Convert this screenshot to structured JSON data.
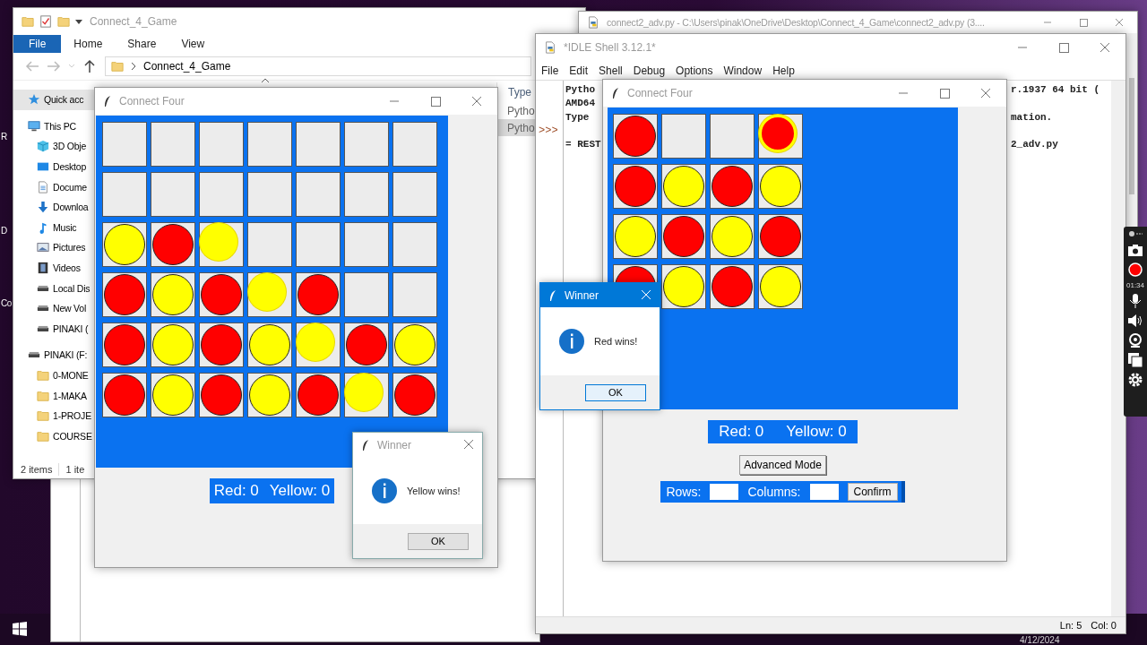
{
  "desktop": {
    "edge_labels": [
      "R",
      "D",
      "Co"
    ]
  },
  "explorer": {
    "title": "Connect_4_Game",
    "ribbon_tabs": [
      {
        "label": "File",
        "selected": true
      },
      {
        "label": "Home",
        "selected": false
      },
      {
        "label": "Share",
        "selected": false
      },
      {
        "label": "View",
        "selected": false
      }
    ],
    "address": "Connect_4_Game",
    "nav": [
      {
        "label": "Quick acc",
        "kind": "star",
        "selected": true
      },
      {
        "label": "This PC",
        "kind": "pc",
        "selected": false,
        "children": [
          {
            "label": "3D Obje",
            "kind": "cube",
            "selected": false
          },
          {
            "label": "Desktop",
            "kind": "desktop",
            "selected": false
          },
          {
            "label": "Docume",
            "kind": "document",
            "selected": false
          },
          {
            "label": "Downloa",
            "kind": "download",
            "selected": false
          },
          {
            "label": "Music",
            "kind": "music",
            "selected": false
          },
          {
            "label": "Pictures",
            "kind": "picture",
            "selected": false
          },
          {
            "label": "Videos",
            "kind": "film",
            "selected": false
          },
          {
            "label": "Local Dis",
            "kind": "drive",
            "selected": false
          },
          {
            "label": "New Vol",
            "kind": "drive",
            "selected": false
          },
          {
            "label": "PINAKI (",
            "kind": "drive",
            "selected": false
          }
        ]
      },
      {
        "label": "PINAKI (F:",
        "kind": "drive",
        "selected": false,
        "children": [
          {
            "label": "0-MONE",
            "kind": "folder",
            "selected": false
          },
          {
            "label": "1-MAKA",
            "kind": "folder",
            "selected": false
          },
          {
            "label": "1-PROJE",
            "kind": "folder",
            "selected": false
          },
          {
            "label": "COURSE",
            "kind": "folder",
            "selected": false
          }
        ]
      }
    ],
    "column_header": "Type",
    "rows": [
      {
        "type": "Pytho",
        "selected": false
      },
      {
        "type": "Pytho",
        "selected": true
      }
    ],
    "status": [
      "2 items",
      "1 ite"
    ]
  },
  "editor": {
    "title": "connect2_adv.py - C:\\Users\\pinak\\OneDrive\\Desktop\\Connect_4_Game\\connect2_adv.py (3...."
  },
  "idle": {
    "title": "*IDLE Shell 3.12.1*",
    "menu": [
      "File",
      "Edit",
      "Shell",
      "Debug",
      "Options",
      "Window",
      "Help"
    ],
    "lines": [
      {
        "left": "Pytho",
        "right": "r.1937 64 bit ("
      },
      {
        "left": "AMD64"
      },
      {
        "left": "Type",
        "right": "mation."
      },
      {
        "gutter": ">>>"
      },
      {
        "left": "= REST",
        "right": "2_adv.py"
      }
    ],
    "status": [
      "Ln: 5",
      "Col: 0"
    ]
  },
  "game_windows": [
    {
      "title": "Connect Four",
      "board": [
        [
          {
            "filled": false
          },
          {
            "filled": false
          },
          {
            "filled": false
          },
          {
            "filled": false
          },
          {
            "filled": false
          },
          {
            "filled": false
          },
          {
            "filled": false
          }
        ],
        [
          {
            "filled": false
          },
          {
            "filled": false
          },
          {
            "filled": false
          },
          {
            "filled": false
          },
          {
            "filled": false
          },
          {
            "filled": false
          },
          {
            "filled": false
          }
        ],
        [
          {
            "filled": true,
            "color": "#ffff00",
            "winning": false
          },
          {
            "filled": true,
            "color": "#ff0000",
            "winning": false
          },
          {
            "filled": true,
            "color": "#ffff00",
            "winning": true
          },
          {
            "filled": false
          },
          {
            "filled": false
          },
          {
            "filled": false
          },
          {
            "filled": false
          }
        ],
        [
          {
            "filled": true,
            "color": "#ff0000",
            "winning": false
          },
          {
            "filled": true,
            "color": "#ffff00",
            "winning": false
          },
          {
            "filled": true,
            "color": "#ff0000",
            "winning": false
          },
          {
            "filled": true,
            "color": "#ffff00",
            "winning": true
          },
          {
            "filled": true,
            "color": "#ff0000",
            "winning": false
          },
          {
            "filled": false
          },
          {
            "filled": false
          }
        ],
        [
          {
            "filled": true,
            "color": "#ff0000",
            "winning": false
          },
          {
            "filled": true,
            "color": "#ffff00",
            "winning": false
          },
          {
            "filled": true,
            "color": "#ff0000",
            "winning": false
          },
          {
            "filled": true,
            "color": "#ffff00",
            "winning": false
          },
          {
            "filled": true,
            "color": "#ffff00",
            "winning": true
          },
          {
            "filled": true,
            "color": "#ff0000",
            "winning": false
          },
          {
            "filled": true,
            "color": "#ffff00",
            "winning": false
          }
        ],
        [
          {
            "filled": true,
            "color": "#ff0000",
            "winning": false
          },
          {
            "filled": true,
            "color": "#ffff00",
            "winning": false
          },
          {
            "filled": true,
            "color": "#ff0000",
            "winning": false
          },
          {
            "filled": true,
            "color": "#ffff00",
            "winning": false
          },
          {
            "filled": true,
            "color": "#ff0000",
            "winning": false
          },
          {
            "filled": true,
            "color": "#ffff00",
            "winning": true
          },
          {
            "filled": true,
            "color": "#ff0000",
            "winning": false
          }
        ]
      ],
      "score_red": "Red: 0",
      "score_yellow": "Yellow: 0"
    },
    {
      "title": "Connect Four",
      "board": [
        [
          {
            "filled": true,
            "color": "#ff0000",
            "winning": false
          },
          {
            "filled": false
          },
          {
            "filled": false
          },
          {
            "filled": true,
            "color": "#ff0000",
            "winning": true
          }
        ],
        [
          {
            "filled": true,
            "color": "#ff0000",
            "winning": false
          },
          {
            "filled": true,
            "color": "#ffff00",
            "winning": false
          },
          {
            "filled": true,
            "color": "#ff0000",
            "winning": false
          },
          {
            "filled": true,
            "color": "#ffff00",
            "winning": false
          }
        ],
        [
          {
            "filled": true,
            "color": "#ffff00",
            "winning": false
          },
          {
            "filled": true,
            "color": "#ff0000",
            "winning": false
          },
          {
            "filled": true,
            "color": "#ffff00",
            "winning": false
          },
          {
            "filled": true,
            "color": "#ff0000",
            "winning": false
          }
        ],
        [
          {
            "filled": true,
            "color": "#ff0000",
            "winning": false
          },
          {
            "filled": true,
            "color": "#ffff00",
            "winning": false
          },
          {
            "filled": true,
            "color": "#ff0000",
            "winning": false
          },
          {
            "filled": true,
            "color": "#ffff00",
            "winning": false
          }
        ]
      ],
      "score_red": "Red: 0",
      "score_yellow": "Yellow: 0",
      "mode_button": "Advanced Mode",
      "rows_label": "Rows:",
      "columns_label": "Columns:",
      "confirm_button": "Confirm"
    }
  ],
  "dialogs": [
    {
      "title": "Winner",
      "active": false,
      "message": "Yellow wins!",
      "button": "OK"
    },
    {
      "title": "Winner",
      "active": true,
      "message": "Red wins!",
      "button": "OK"
    }
  ],
  "recorder": {
    "timer": "01:34"
  },
  "taskbar": {
    "date": "4/12/2024"
  }
}
